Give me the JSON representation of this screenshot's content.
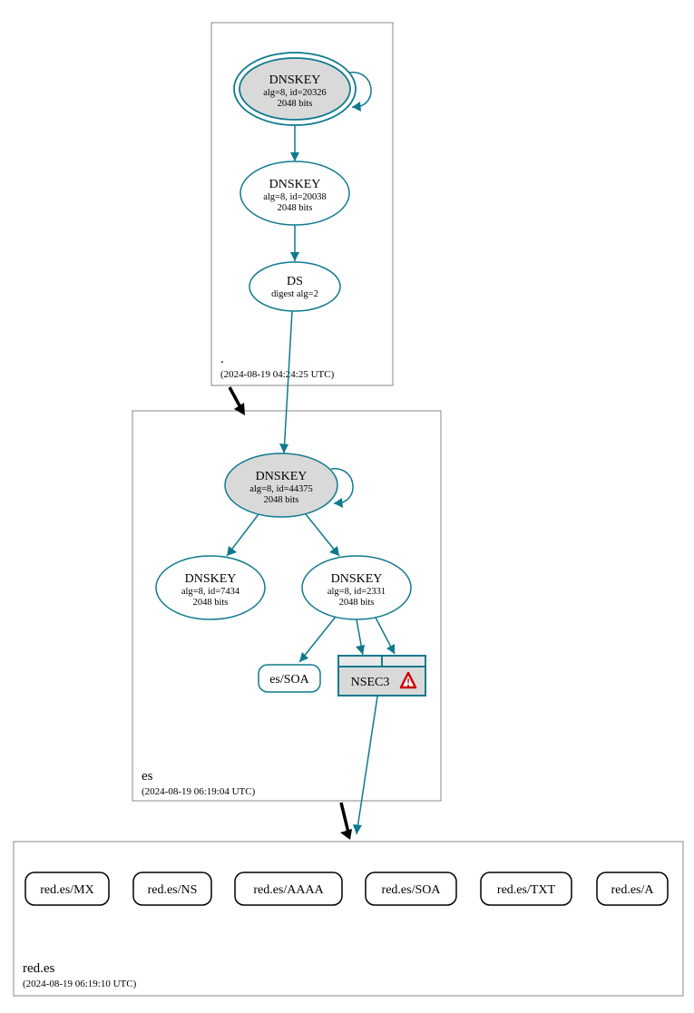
{
  "zones": {
    "root": {
      "label": ".",
      "timestamp": "(2024-08-19 04:24:25 UTC)"
    },
    "es": {
      "label": "es",
      "timestamp": "(2024-08-19 06:19:04 UTC)"
    },
    "redes": {
      "label": "red.es",
      "timestamp": "(2024-08-19 06:19:10 UTC)"
    }
  },
  "nodes": {
    "root_ksk": {
      "title": "DNSKEY",
      "line2": "alg=8, id=20326",
      "line3": "2048 bits"
    },
    "root_zsk": {
      "title": "DNSKEY",
      "line2": "alg=8, id=20038",
      "line3": "2048 bits"
    },
    "root_ds": {
      "title": "DS",
      "line2": "digest alg=2"
    },
    "es_ksk": {
      "title": "DNSKEY",
      "line2": "alg=8, id=44375",
      "line3": "2048 bits"
    },
    "es_zsk1": {
      "title": "DNSKEY",
      "line2": "alg=8, id=7434",
      "line3": "2048 bits"
    },
    "es_zsk2": {
      "title": "DNSKEY",
      "line2": "alg=8, id=2331",
      "line3": "2048 bits"
    },
    "es_soa": {
      "label": "es/SOA"
    },
    "nsec3": {
      "label": "NSEC3"
    },
    "r_mx": {
      "label": "red.es/MX"
    },
    "r_ns": {
      "label": "red.es/NS"
    },
    "r_aaaa": {
      "label": "red.es/AAAA"
    },
    "r_soa": {
      "label": "red.es/SOA"
    },
    "r_txt": {
      "label": "red.es/TXT"
    },
    "r_a": {
      "label": "red.es/A"
    }
  }
}
